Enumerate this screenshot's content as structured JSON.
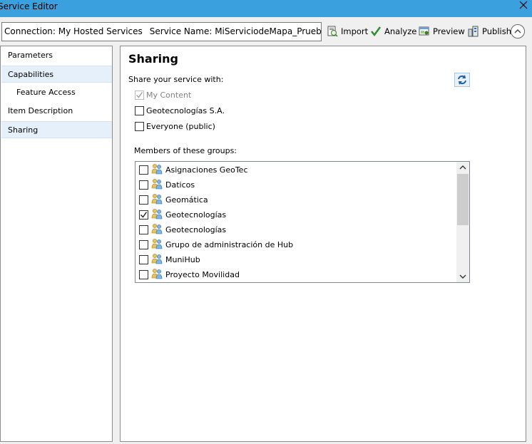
{
  "window": {
    "title": "Service Editor"
  },
  "toolbar": {
    "connection_label": "Connection: My Hosted Services",
    "service_name_label": "Service Name: MiServiciodeMapa_Prueba",
    "import_label": "Import",
    "analyze_label": "Analyze",
    "preview_label": "Preview",
    "publish_label": "Publish"
  },
  "sidebar": {
    "items": [
      {
        "label": "Parameters",
        "selected": false
      },
      {
        "label": "Capabilities",
        "selected": true
      },
      {
        "label": "Feature Access",
        "selected": false
      },
      {
        "label": "Item Description",
        "selected": false
      },
      {
        "label": "Sharing",
        "selected": true
      }
    ]
  },
  "sharing": {
    "title": "Sharing",
    "share_with_label": "Share your service with:",
    "options": [
      {
        "label": "My Content",
        "checked": true,
        "disabled": true
      },
      {
        "label": "Geotecnologías S.A.",
        "checked": false,
        "disabled": false
      },
      {
        "label": "Everyone (public)",
        "checked": false,
        "disabled": false
      }
    ],
    "members_label": "Members of these groups:",
    "groups": [
      {
        "label": "Asignaciones GeoTec",
        "checked": false
      },
      {
        "label": "Daticos",
        "checked": false
      },
      {
        "label": "Geomática",
        "checked": false
      },
      {
        "label": "Geotecnologías",
        "checked": true
      },
      {
        "label": "Geotecnologías",
        "checked": false
      },
      {
        "label": "Grupo de administración de Hub",
        "checked": false
      },
      {
        "label": "MuniHub",
        "checked": false
      },
      {
        "label": "Proyecto Movilidad",
        "checked": false
      }
    ]
  },
  "colors": {
    "titlebar": "#3ba0de",
    "selected_item": "#e5f0fb",
    "panel_border": "#8c8c8c",
    "window_bg": "#f0f0f0"
  }
}
